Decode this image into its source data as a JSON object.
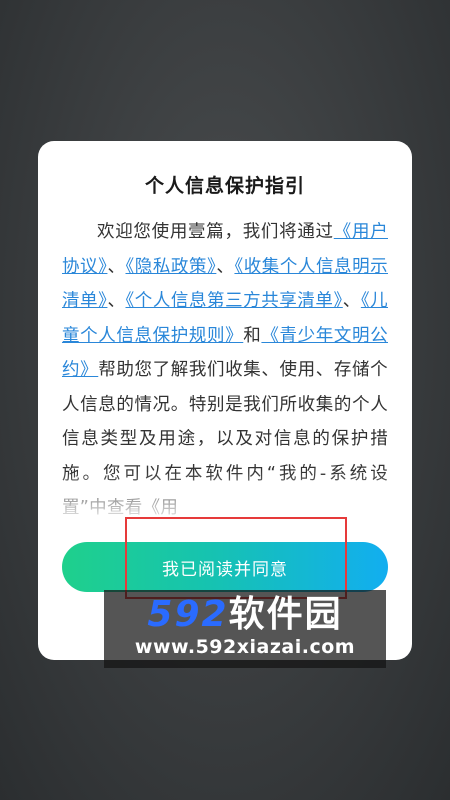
{
  "dialog": {
    "title": "个人信息保护指引",
    "intro_before": "欢迎您使用壹篇，我们将通过",
    "links": [
      "《用户协议》",
      "《隐私政策》",
      "《收集个人信息明示清单》",
      "《个人信息第三方共享清单》",
      "《儿童个人信息保护规则》",
      "《青少年文明公约》"
    ],
    "sep": "、",
    "and": "和",
    "body_after": "帮助您了解我们收集、使用、存储个人信息的情况。特别是我们所收集的个人信息类型及用途，以及对信息的保护措施。您可以在本软件内“我的-系统设置”中查看《用",
    "agree_label": "我已阅读并同意"
  },
  "watermark": {
    "logo_number": "592",
    "logo_text": "软件园",
    "url": "www.592xiazai.com"
  },
  "colors": {
    "link": "#2a87d9",
    "button_start": "#1fd08c",
    "button_end": "#12aef0",
    "highlight": "#e63a3a"
  }
}
